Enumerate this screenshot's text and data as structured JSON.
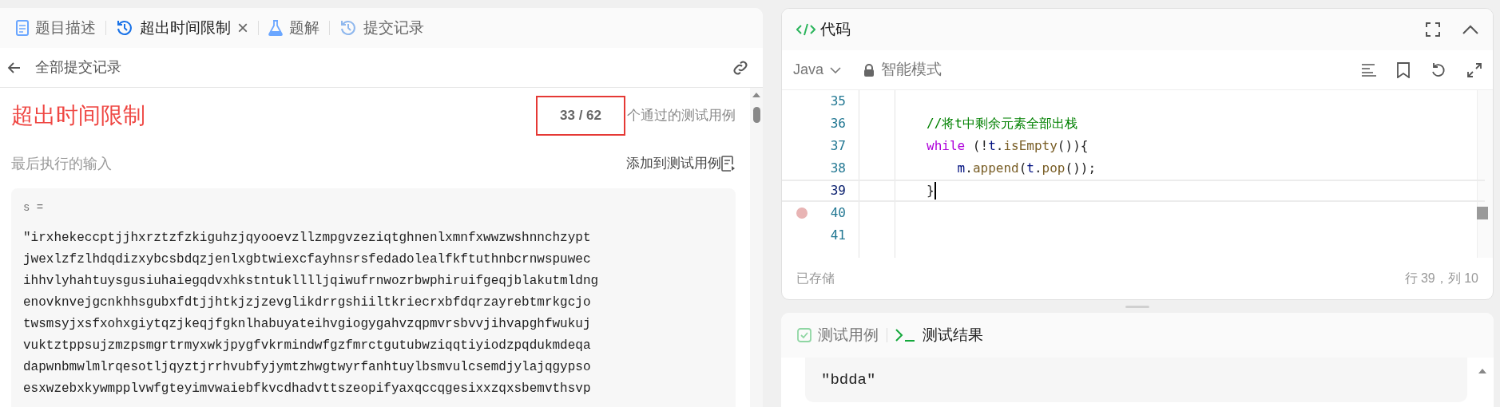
{
  "left_tabs": [
    {
      "label": "题目描述",
      "kind": "document",
      "selected": false,
      "closable": false
    },
    {
      "label": "超出时间限制",
      "kind": "history",
      "selected": true,
      "closable": true,
      "close": "×"
    },
    {
      "label": "题解",
      "kind": "flask",
      "selected": false,
      "closable": false
    },
    {
      "label": "提交记录",
      "kind": "history",
      "selected": false,
      "closable": false
    }
  ],
  "back_link": "全部提交记录",
  "result": {
    "status": "超出时间限制",
    "passed": "33 / 62",
    "passed_label": "个通过的测试用例"
  },
  "last_input": {
    "label": "最后执行的输入",
    "add_button": "添加到测试用例",
    "var_name": "s =",
    "value_lines": [
      "\"irxhekeccptjjhxrztzfzkiguhzjqyooevzllzmpgvzeziqtghnenlxmnfxwwzwshnnchzypt",
      "jwexlzfzlhdqdizxybcsbdqzjenlxgbtwiexcfayhnsrsfedadolealfkftuthnbcrnwspuwec",
      "ihhvlyhahtuysgusiuhaiegqdvxhkstntuklllljqiwufrnwozrbwphiruifgeqjblakutmldng",
      "enovknvejgcnkhhsgubxfdtjjhtkjzjzevglikdrrgshiiltkriecrxbfdqrzayrebtmrkgcjo",
      "twsmsyjxsfxohxgiytqzjkeqjfgknlhabuyateihvgiogygahvzqpmvrsbvvjihvapghfwukuj",
      "vuktztppsujzmzpsmgrtrmyxwkjpygfvkrmindwfgzfmrctgutubwziqqtiyiodzpqdukmdeqa",
      "dapwnbmwlmlrqesotljqyztjrrhvubfyjymtzhwgtwyrfanhtuylbsmvulcsemdjylajqgypso",
      "esxwzebxkywmpplvwfgteyimvwaiebfkvcdhadvttszeopifyaxqccqgesixxzqxsbemvthsvp"
    ]
  },
  "code_panel": {
    "title": "代码",
    "language": "Java",
    "mode": "智能模式",
    "status": "已存储",
    "cursor": "行 39，列 10",
    "lines": [
      {
        "number": "35",
        "current": false,
        "breakpoint": false
      },
      {
        "number": "36",
        "current": false,
        "breakpoint": false,
        "tokens": [
          {
            "text": "        //将t中剩余元素全部出栈",
            "kind": "comment"
          }
        ]
      },
      {
        "number": "37",
        "current": false,
        "breakpoint": false,
        "tokens": [
          {
            "text": "        while",
            "kind": "keyword"
          },
          {
            "text": " (!",
            "kind": "punct"
          },
          {
            "text": "t",
            "kind": "var"
          },
          {
            "text": ".",
            "kind": "punct"
          },
          {
            "text": "isEmpty",
            "kind": "method"
          },
          {
            "text": "()){",
            "kind": "punct"
          }
        ]
      },
      {
        "number": "38",
        "current": false,
        "breakpoint": false,
        "tokens": [
          {
            "text": "            m",
            "kind": "var"
          },
          {
            "text": ".",
            "kind": "punct"
          },
          {
            "text": "append",
            "kind": "method"
          },
          {
            "text": "(",
            "kind": "punct"
          },
          {
            "text": "t",
            "kind": "var"
          },
          {
            "text": ".",
            "kind": "punct"
          },
          {
            "text": "pop",
            "kind": "method"
          },
          {
            "text": "());",
            "kind": "punct"
          }
        ]
      },
      {
        "number": "39",
        "current": true,
        "breakpoint": false,
        "tokens": [
          {
            "text": "        }",
            "kind": "punct"
          }
        ]
      },
      {
        "number": "40",
        "current": false,
        "breakpoint": true
      },
      {
        "number": "41",
        "current": false,
        "breakpoint": false
      }
    ]
  },
  "test_panel": {
    "tabs": [
      {
        "label": "测试用例",
        "kind": "check",
        "selected": false
      },
      {
        "label": "测试结果",
        "kind": "terminal",
        "selected": true
      }
    ],
    "output": "\"bdda\""
  }
}
